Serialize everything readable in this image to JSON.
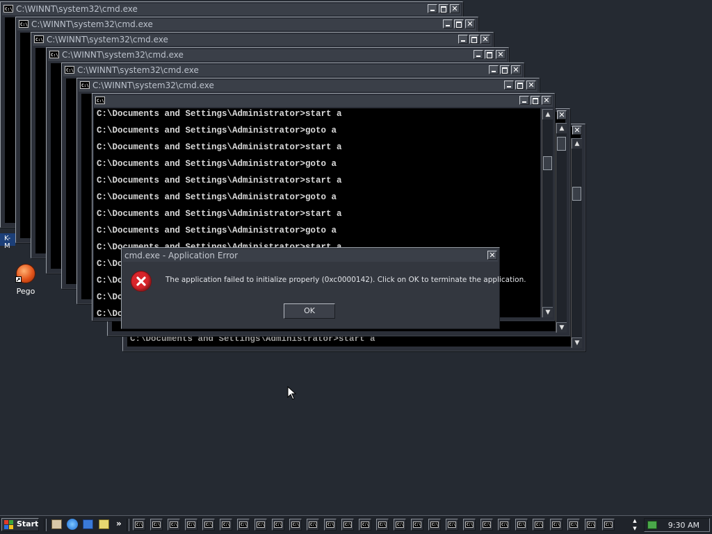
{
  "windows": [
    {
      "title": "C:\\WINNT\\system32\\cmd.exe"
    },
    {
      "title": "C:\\WINNT\\system32\\cmd.exe"
    },
    {
      "title": "C:\\WINNT\\system32\\cmd.exe"
    },
    {
      "title": "C:\\WINNT\\system32\\cmd.exe"
    },
    {
      "title": "C:\\WINNT\\system32\\cmd.exe"
    },
    {
      "title": "C:\\WINNT\\system32\\cmd.exe"
    },
    {
      "title": ""
    }
  ],
  "console": {
    "lines": [
      "C:\\Documents and Settings\\Administrator>start a",
      "C:\\Documents and Settings\\Administrator>goto a",
      "C:\\Documents and Settings\\Administrator>start a",
      "C:\\Documents and Settings\\Administrator>goto a",
      "C:\\Documents and Settings\\Administrator>start a",
      "C:\\Documents and Settings\\Administrator>goto a",
      "C:\\Documents and Settings\\Administrator>start a",
      "C:\\Documents and Settings\\Administrator>goto a",
      "C:\\Documents and Settings\\Administrator>start a",
      "C:\\Do",
      "C:\\Do",
      "C:\\Do",
      "C:\\Do"
    ],
    "back_line": "C:\\Documents and Settings\\Administrator>start a"
  },
  "dialog": {
    "title": "cmd.exe - Application Error",
    "message": "The application failed to initialize properly (0xc0000142). Click on OK to terminate the application.",
    "ok_label": "OK",
    "close_glyph": "✕"
  },
  "desktop": {
    "icon_label": "Pego",
    "partial_label": "K-M"
  },
  "taskbar": {
    "start_label": "Start",
    "chevron": "»",
    "clock": "9:30 AM",
    "button_count": 28,
    "button_glyph": "C:\\"
  },
  "glyphs": {
    "close": "✕",
    "up": "▲",
    "down": "▼",
    "cmd_icon": "C:\\"
  },
  "colors": {
    "desktop": "#252a32",
    "titlebar": "#3a3f48",
    "dialog": "#33373f",
    "error_red": "#d8252b"
  }
}
